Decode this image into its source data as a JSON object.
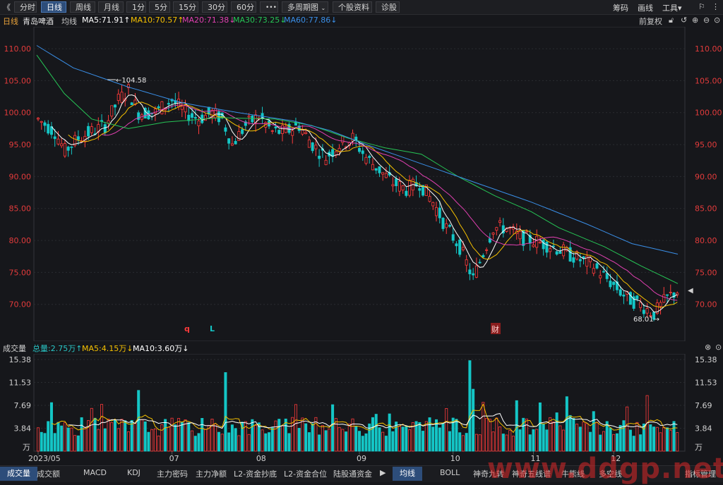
{
  "toolbar": {
    "back_glyph": "《",
    "periods": [
      "分时",
      "日线",
      "周线",
      "月线",
      "1分",
      "5分",
      "15分",
      "30分",
      "60分"
    ],
    "active_period": "日线",
    "more_label": "•••",
    "multi_period_label": "多周期图",
    "stock_info_label": "个股资料",
    "diagnose_label": "诊股",
    "right_items": [
      "筹码",
      "画线",
      "工具▾"
    ],
    "window_controls": [
      "⚐",
      "—",
      "×"
    ]
  },
  "infobar": {
    "period": "日线",
    "stock_name": "青岛啤酒",
    "indicator": "均线",
    "ma5": "MA5:71.91↑",
    "ma10": "MA10:70.57↑",
    "ma20": "MA20:71.38↓",
    "ma30": "MA30:73.25↓",
    "ma60": "MA60:77.86↓",
    "adjust_label": "前复权",
    "colors": {
      "ma5": "#ffffff",
      "ma10": "#f5c000",
      "ma20": "#e040b0",
      "ma30": "#26c455",
      "ma60": "#3a8fe8"
    }
  },
  "volbar": {
    "title": "成交量",
    "total": "总量:2.75万↑",
    "ma5": "MA5:4.15万↓",
    "ma10": "MA10:3.60万↓"
  },
  "bottom_tabs": [
    "成交量",
    "成交额",
    "MACD",
    "KDJ",
    "主力密码",
    "主力净额",
    "L2-资金抄底",
    "L2-资金合位",
    "陆股通资金"
  ],
  "bottom_tabs_right": [
    "均线",
    "BOLL",
    "神奇九转",
    "神奇五线谱",
    "牛熊线",
    "多空线",
    "指标管理"
  ],
  "watermark": "www.ddgp.net",
  "chart_data": {
    "type": "candlestick",
    "price_axis": {
      "ticks": [
        "110.00",
        "105.00",
        "100.00",
        "95.00",
        "90.00",
        "85.00",
        "80.00",
        "75.00",
        "70.00"
      ],
      "ylim": [
        66,
        111
      ]
    },
    "volume_axis": {
      "ticks": [
        "15.38",
        "11.53",
        "7.69",
        "3.84"
      ],
      "unit": "万",
      "ylim": [
        0,
        15.38
      ]
    },
    "x_labels": [
      "2023/05",
      "07",
      "08",
      "09",
      "10",
      "11",
      "12"
    ],
    "annotations": {
      "high": "104.58",
      "low": "68.01",
      "markers": [
        "q",
        "L",
        "财"
      ]
    },
    "ma_close_points": {
      "ma60": [
        [
          0,
          110.5
        ],
        [
          40,
          107
        ],
        [
          100,
          104
        ],
        [
          160,
          101.5
        ],
        [
          220,
          100
        ],
        [
          280,
          98.7
        ],
        [
          320,
          97.2
        ],
        [
          360,
          95
        ],
        [
          420,
          92
        ],
        [
          480,
          89
        ],
        [
          540,
          86
        ],
        [
          600,
          82.6
        ],
        [
          650,
          79.5
        ],
        [
          700,
          77.86
        ]
      ],
      "ma30": [
        [
          0,
          109
        ],
        [
          30,
          103
        ],
        [
          60,
          99
        ],
        [
          100,
          97.5
        ],
        [
          140,
          98.5
        ],
        [
          200,
          99.2
        ],
        [
          260,
          99
        ],
        [
          300,
          98
        ],
        [
          340,
          96
        ],
        [
          380,
          94.5
        ],
        [
          420,
          93.5
        ],
        [
          460,
          90
        ],
        [
          500,
          87
        ],
        [
          540,
          84.5
        ],
        [
          570,
          82
        ],
        [
          620,
          79
        ],
        [
          660,
          76
        ],
        [
          700,
          73.25
        ]
      ]
    }
  }
}
